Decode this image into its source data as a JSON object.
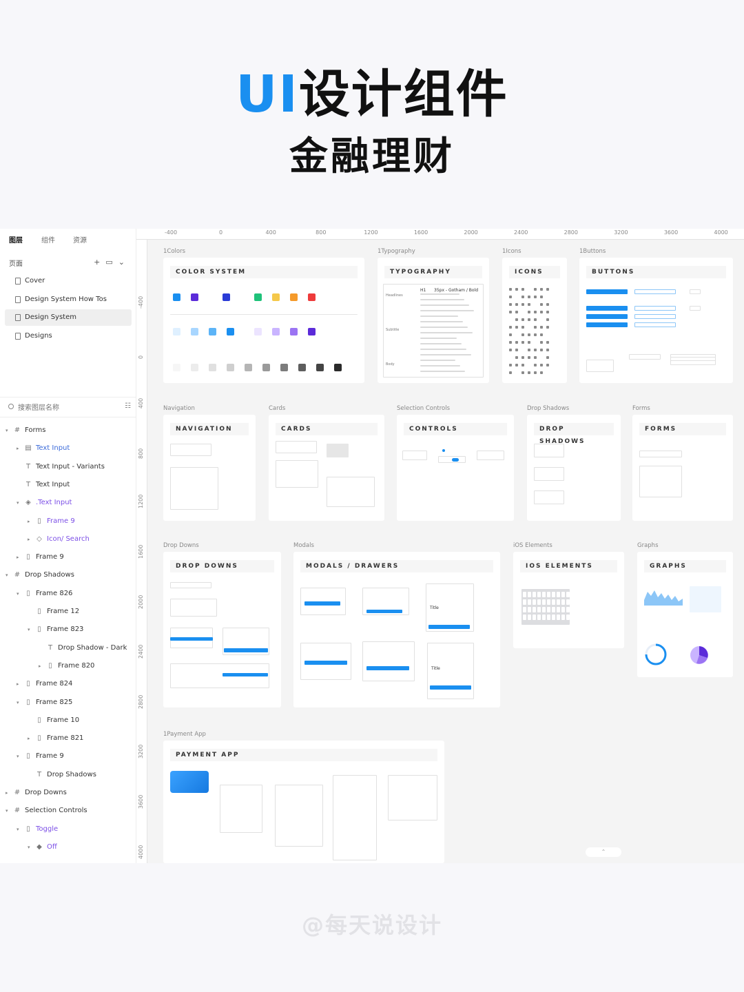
{
  "hero": {
    "title_accent": "UI",
    "title_rest": "设计组件",
    "subtitle": "金融理财"
  },
  "sidebar": {
    "tabs": [
      "图层",
      "组件",
      "资源"
    ],
    "pages_label": "页面",
    "pages": [
      "Cover",
      "Design System How Tos",
      "Design System",
      "Designs"
    ],
    "search_placeholder": "搜索图层名称",
    "layers": [
      {
        "label": "Forms",
        "icon": "frame-icon",
        "caret": "▾",
        "indent": 0,
        "style": "normal"
      },
      {
        "label": "Text Input",
        "icon": "component-icon",
        "caret": "▸",
        "indent": 1,
        "style": "blue"
      },
      {
        "label": "Text Input - Variants",
        "icon": "text-icon",
        "caret": "",
        "indent": 1,
        "style": "normal"
      },
      {
        "label": "Text Input",
        "icon": "text-icon",
        "caret": "",
        "indent": 1,
        "style": "normal"
      },
      {
        "label": ".Text Input",
        "icon": "component-set-icon",
        "caret": "▾",
        "indent": 1,
        "style": "purple"
      },
      {
        "label": "Frame 9",
        "icon": "frame-outline-icon",
        "caret": "▸",
        "indent": 2,
        "style": "purple"
      },
      {
        "label": "Icon/ Search",
        "icon": "instance-icon",
        "caret": "▸",
        "indent": 2,
        "style": "purple"
      },
      {
        "label": "Frame 9",
        "icon": "frame-outline-icon",
        "caret": "▸",
        "indent": 1,
        "style": "normal"
      },
      {
        "label": "Drop Shadows",
        "icon": "frame-icon",
        "caret": "▾",
        "indent": 0,
        "style": "normal"
      },
      {
        "label": "Frame 826",
        "icon": "frame-outline-icon",
        "caret": "▾",
        "indent": 1,
        "style": "normal"
      },
      {
        "label": "Frame 12",
        "icon": "frame-outline-icon",
        "caret": "",
        "indent": 2,
        "style": "normal"
      },
      {
        "label": "Frame 823",
        "icon": "frame-outline-icon",
        "caret": "▾",
        "indent": 2,
        "style": "normal"
      },
      {
        "label": "Drop Shadow - Dark",
        "icon": "text-icon",
        "caret": "",
        "indent": 3,
        "style": "normal"
      },
      {
        "label": "Frame 820",
        "icon": "frame-outline-icon",
        "caret": "▸",
        "indent": 3,
        "style": "normal"
      },
      {
        "label": "Frame 824",
        "icon": "frame-outline-icon",
        "caret": "▸",
        "indent": 1,
        "style": "normal"
      },
      {
        "label": "Frame 825",
        "icon": "frame-outline-icon",
        "caret": "▾",
        "indent": 1,
        "style": "normal"
      },
      {
        "label": "Frame 10",
        "icon": "frame-outline-icon",
        "caret": "",
        "indent": 2,
        "style": "normal"
      },
      {
        "label": "Frame 821",
        "icon": "frame-outline-icon",
        "caret": "▸",
        "indent": 2,
        "style": "normal"
      },
      {
        "label": "Frame 9",
        "icon": "frame-outline-icon",
        "caret": "▾",
        "indent": 1,
        "style": "normal"
      },
      {
        "label": "Drop Shadows",
        "icon": "text-icon",
        "caret": "",
        "indent": 2,
        "style": "normal"
      },
      {
        "label": "Drop Downs",
        "icon": "frame-icon",
        "caret": "▸",
        "indent": 0,
        "style": "normal"
      },
      {
        "label": "Selection Controls",
        "icon": "frame-icon",
        "caret": "▾",
        "indent": 0,
        "style": "normal"
      },
      {
        "label": "Toggle",
        "icon": "frame-outline-icon",
        "caret": "▾",
        "indent": 1,
        "style": "purple"
      },
      {
        "label": "Off",
        "icon": "variant-icon",
        "caret": "▾",
        "indent": 2,
        "style": "purple"
      }
    ]
  },
  "ruler": {
    "top": [
      "-400",
      "0",
      "400",
      "800",
      "1200",
      "1600",
      "2000",
      "2400",
      "2800",
      "3200",
      "3600",
      "4000"
    ],
    "left": [
      "-400",
      "0",
      "400",
      "800",
      "1200",
      "1600",
      "2000",
      "2400",
      "2800",
      "3200",
      "3600",
      "4000"
    ]
  },
  "frames": {
    "colors": {
      "label": "1Colors",
      "title": "COLOR SYSTEM"
    },
    "typography": {
      "label": "1Typography",
      "title": "TYPOGRAPHY",
      "h1": "H1",
      "h1_spec": "35px - Gotham / Bold",
      "row_labels": [
        "Headlines",
        "Subtitle",
        "Body"
      ]
    },
    "icons": {
      "label": "1Icons",
      "title": "ICONS"
    },
    "buttons": {
      "label": "1Buttons",
      "title": "BUTTONS"
    },
    "navigation": {
      "label": "Navigation",
      "title": "NAVIGATION"
    },
    "cards": {
      "label": "Cards",
      "title": "CARDS"
    },
    "controls": {
      "label": "Selection Controls",
      "title": "CONTROLS"
    },
    "shadows": {
      "label": "Drop Shadows",
      "title": "DROP SHADOWS"
    },
    "forms": {
      "label": "Forms",
      "title": "FORMS"
    },
    "dropdowns": {
      "label": "Drop Downs",
      "title": "DROP DOWNS"
    },
    "modals": {
      "label": "Modals",
      "title": "MODALS / DRAWERS",
      "card_title": "Title"
    },
    "ios": {
      "label": "iOS Elements",
      "title": "IOS ELEMENTS"
    },
    "graphs": {
      "label": "Graphs",
      "title": "GRAPHS"
    },
    "payment": {
      "label": "1Payment App",
      "title": "PAYMENT APP"
    }
  },
  "colors": {
    "accent": "#1a8ff0",
    "primary_swatches": [
      "#1a8ff0",
      "#5b2bd9",
      "#2a3bd6",
      "#1fc27a",
      "#f5c84a",
      "#f59a2a",
      "#ee3b3b"
    ],
    "blue_tints": [
      "#dff0ff",
      "#a8d6ff",
      "#5cb4f7",
      "#1a8ff0"
    ],
    "purple_tints": [
      "#ece4ff",
      "#c9b4ff",
      "#9b74f3",
      "#5b2bd9"
    ],
    "grays": [
      "#f6f6f6",
      "#ececec",
      "#e0e0e0",
      "#cfcfcf",
      "#b5b5b5",
      "#9a9a9a",
      "#7c7c7c",
      "#5e5e5e",
      "#444",
      "#2b2b2b"
    ]
  },
  "watermark": "@每天说设计"
}
